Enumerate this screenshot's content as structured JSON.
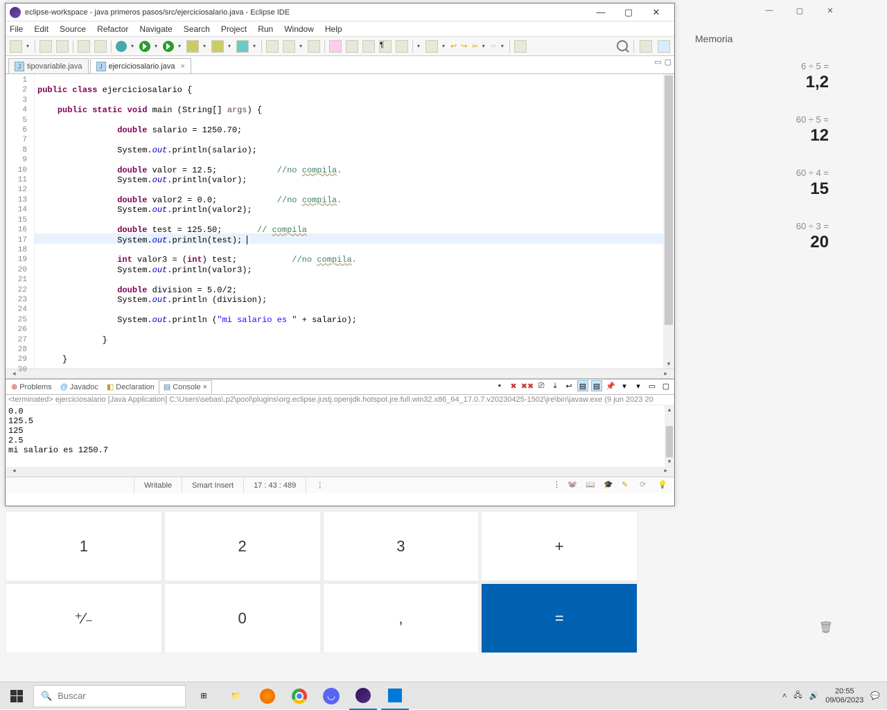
{
  "eclipse": {
    "title": "eclipse-workspace - java primeros pasos/src/ejerciciosalario.java - Eclipse IDE",
    "menus": [
      "File",
      "Edit",
      "Source",
      "Refactor",
      "Navigate",
      "Search",
      "Project",
      "Run",
      "Window",
      "Help"
    ],
    "tabs": [
      "tipovariable.java",
      "ejerciciosalario.java"
    ],
    "bottom_tabs": [
      "Problems",
      "Javadoc",
      "Declaration",
      "Console"
    ],
    "status": {
      "writable": "Writable",
      "insert": "Smart Insert",
      "position": "17 : 43 : 489"
    },
    "console": {
      "run_line": "<terminated> ejerciciosalario [Java Application] C:\\Users\\sebas\\.p2\\pool\\plugins\\org.eclipse.justj.openjdk.hotspot.jre.full.win32.x86_64_17.0.7.v20230425-1502\\jre\\bin\\javaw.exe  (9 jun 2023 20",
      "output": [
        "0.0",
        "125.5",
        "125",
        "2.5",
        "mi salario es 1250.7"
      ]
    },
    "code": {
      "lines": 30,
      "tokens": [
        [],
        [
          [
            "kw",
            "public"
          ],
          [
            "",
            " "
          ],
          [
            "kw",
            "class"
          ],
          [
            "",
            " ejerciciosalario {"
          ]
        ],
        [],
        [
          [
            "",
            "    "
          ],
          [
            "kw",
            "public"
          ],
          [
            "",
            " "
          ],
          [
            "kw",
            "static"
          ],
          [
            "",
            " "
          ],
          [
            "kw",
            "void"
          ],
          [
            "",
            " main (String[] "
          ],
          [
            "arg",
            "args"
          ],
          [
            "",
            ") {"
          ]
        ],
        [],
        [
          [
            "",
            "                "
          ],
          [
            "kw",
            "double"
          ],
          [
            "",
            " salario = 1250.70;"
          ]
        ],
        [],
        [
          [
            "",
            "                System."
          ],
          [
            "field",
            "out"
          ],
          [
            "",
            ".println(salario);"
          ]
        ],
        [],
        [
          [
            "",
            "                "
          ],
          [
            "kw",
            "double"
          ],
          [
            "",
            " valor = 12.5;            "
          ],
          [
            "cmt-n",
            "//no "
          ],
          [
            "cmt-u",
            "compila"
          ],
          [
            "cmt-n",
            "."
          ]
        ],
        [
          [
            "",
            "                System."
          ],
          [
            "field",
            "out"
          ],
          [
            "",
            ".println(valor);"
          ]
        ],
        [],
        [
          [
            "",
            "                "
          ],
          [
            "kw",
            "double"
          ],
          [
            "",
            " valor2 = 0.0;            "
          ],
          [
            "cmt-n",
            "//no "
          ],
          [
            "cmt-u",
            "compila"
          ],
          [
            "cmt-n",
            "."
          ]
        ],
        [
          [
            "",
            "                System."
          ],
          [
            "field",
            "out"
          ],
          [
            "",
            ".println(valor2);"
          ]
        ],
        [],
        [
          [
            "",
            "                "
          ],
          [
            "kw",
            "double"
          ],
          [
            "",
            " test = 125.50;       "
          ],
          [
            "cmt-n",
            "// "
          ],
          [
            "cmt-u",
            "compila"
          ]
        ],
        [
          [
            "",
            "                System."
          ],
          [
            "field",
            "out"
          ],
          [
            "",
            ".println(test); "
          ],
          [
            "cursor",
            ""
          ]
        ],
        [],
        [
          [
            "",
            "                "
          ],
          [
            "kw",
            "int"
          ],
          [
            "",
            " valor3 = ("
          ],
          [
            "kw",
            "int"
          ],
          [
            "",
            ") test;           "
          ],
          [
            "cmt-n",
            "//no "
          ],
          [
            "cmt-u",
            "compila"
          ],
          [
            "cmt-n",
            "."
          ]
        ],
        [
          [
            "",
            "                System."
          ],
          [
            "field",
            "out"
          ],
          [
            "",
            ".println(valor3);"
          ]
        ],
        [],
        [
          [
            "",
            "                "
          ],
          [
            "kw",
            "double"
          ],
          [
            "",
            " division = 5.0/2;"
          ]
        ],
        [
          [
            "",
            "                System."
          ],
          [
            "field",
            "out"
          ],
          [
            "",
            ".println (division);"
          ]
        ],
        [],
        [
          [
            "",
            "                System."
          ],
          [
            "field",
            "out"
          ],
          [
            "",
            ".println ("
          ],
          [
            "str",
            "\"mi salario es \""
          ],
          [
            "",
            " + salario);"
          ]
        ],
        [],
        [
          [
            "",
            "             }"
          ]
        ],
        [],
        [
          [
            "",
            "     }"
          ]
        ],
        []
      ]
    }
  },
  "calc": {
    "memory_label": "Memoria",
    "history": [
      {
        "expr": "6  ÷  5 =",
        "result": "1,2"
      },
      {
        "expr": "60  ÷  5 =",
        "result": "12"
      },
      {
        "expr": "60  ÷  4 =",
        "result": "15"
      },
      {
        "expr": "60  ÷  3 =",
        "result": "20"
      }
    ],
    "keys": [
      "1",
      "2",
      "3",
      "+",
      "⁺∕₋",
      "0",
      ",",
      "="
    ]
  },
  "taskbar": {
    "search_placeholder": "Buscar",
    "time": "20:55",
    "date": "09/06/2023"
  }
}
